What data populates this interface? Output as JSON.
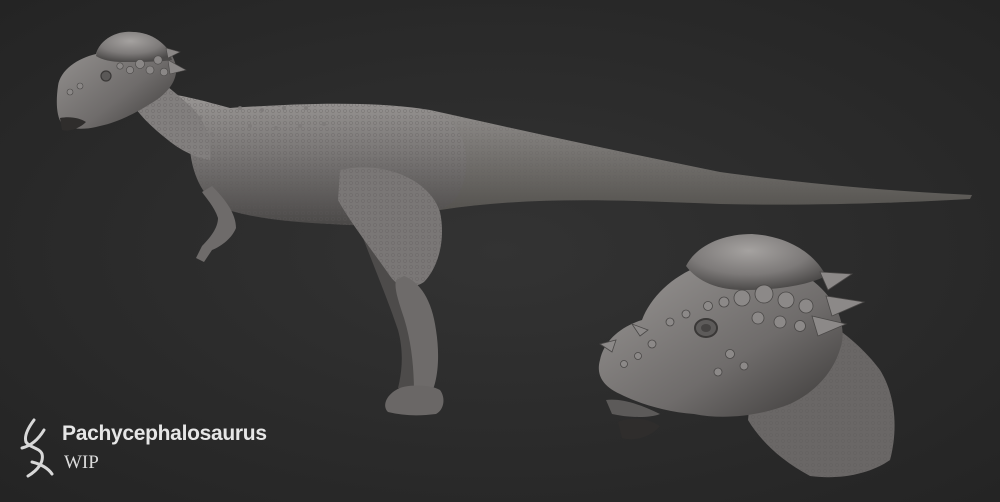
{
  "caption": {
    "title": "Pachycephalosaurus",
    "subtitle": "WIP"
  },
  "colors": {
    "background": "#2b2b2b",
    "clay_light": "#8e8b89",
    "clay_mid": "#6b6867",
    "clay_dark": "#3f3d3c",
    "caption_text": "#e6e6e6"
  },
  "figures": {
    "full_body": "full-body-side-view",
    "head_detail": "head-close-up-view"
  },
  "icons": {
    "logo": "artist-signature-logo"
  }
}
